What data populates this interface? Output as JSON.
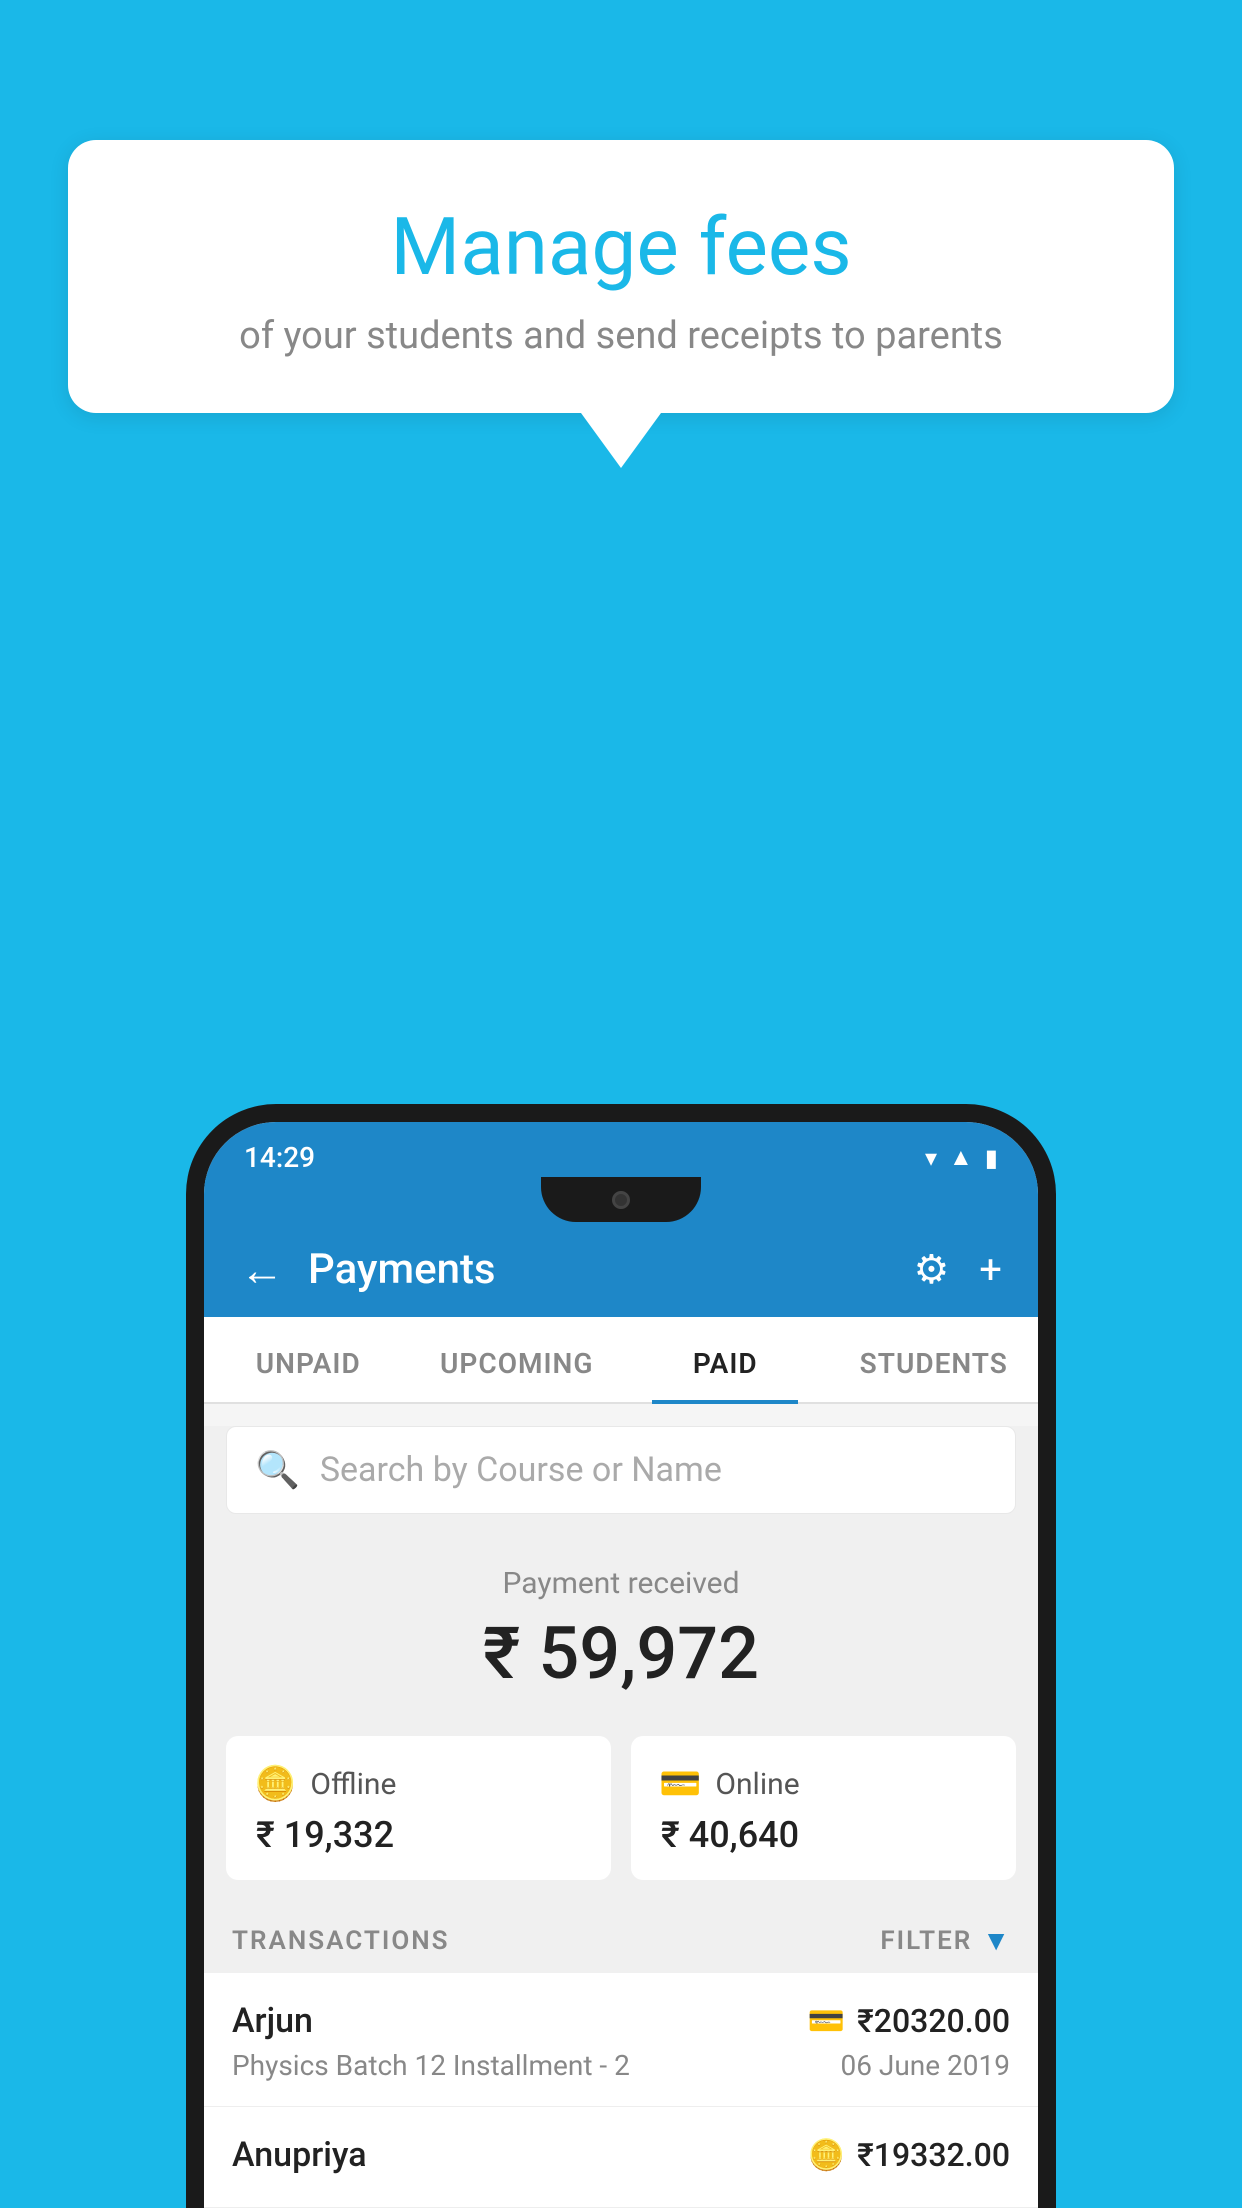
{
  "background_color": "#1ab8e8",
  "speech_bubble": {
    "title": "Manage fees",
    "subtitle": "of your students and send receipts to parents"
  },
  "status_bar": {
    "time": "14:29",
    "icons": [
      "wifi",
      "signal",
      "battery"
    ]
  },
  "header": {
    "title": "Payments",
    "back_label": "←",
    "gear_label": "⚙",
    "plus_label": "+"
  },
  "tabs": [
    {
      "label": "UNPAID",
      "active": false
    },
    {
      "label": "UPCOMING",
      "active": false
    },
    {
      "label": "PAID",
      "active": true
    },
    {
      "label": "STUDENTS",
      "active": false
    }
  ],
  "search": {
    "placeholder": "Search by Course or Name"
  },
  "payment_received": {
    "label": "Payment received",
    "amount": "₹ 59,972"
  },
  "cards": [
    {
      "type": "Offline",
      "amount": "₹ 19,332",
      "icon": "💳"
    },
    {
      "type": "Online",
      "amount": "₹ 40,640",
      "icon": "💳"
    }
  ],
  "transactions": {
    "label": "TRANSACTIONS",
    "filter_label": "FILTER",
    "items": [
      {
        "name": "Arjun",
        "course": "Physics Batch 12 Installment - 2",
        "amount": "₹20320.00",
        "date": "06 June 2019",
        "pay_type": "online"
      },
      {
        "name": "Anupriya",
        "course": "",
        "amount": "₹19332.00",
        "date": "",
        "pay_type": "offline"
      }
    ]
  }
}
